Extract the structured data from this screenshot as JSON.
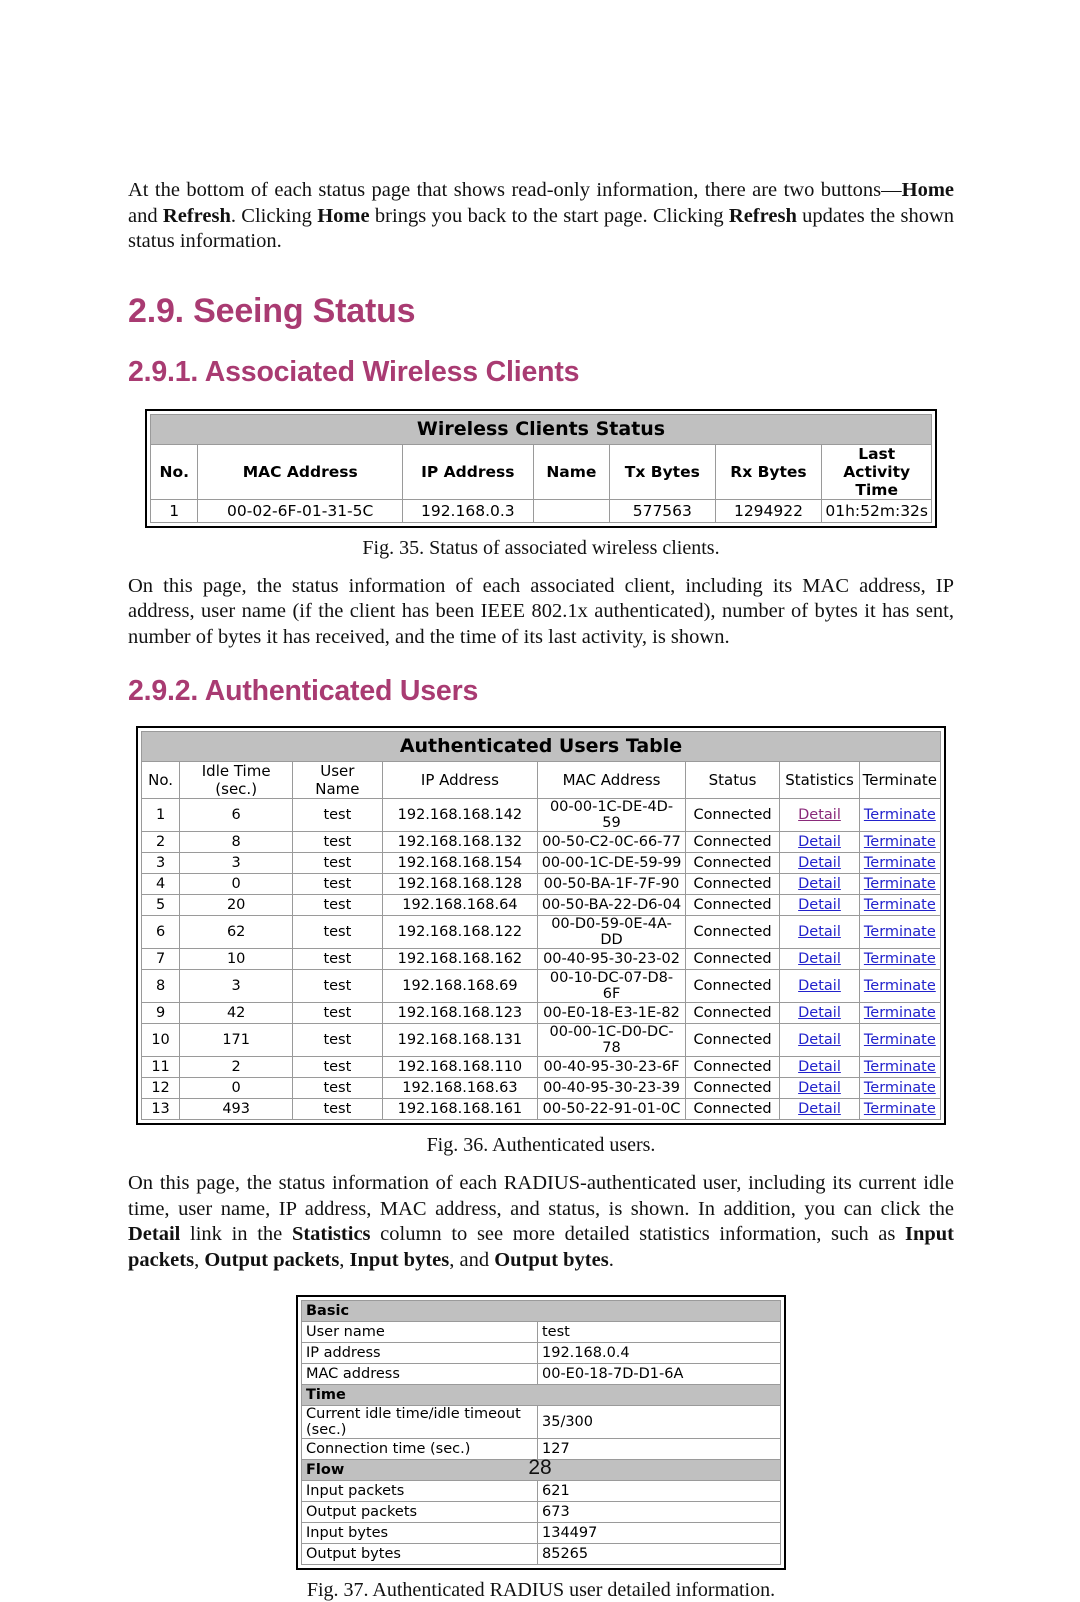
{
  "document": {
    "page_number": "28",
    "heading_color": "#A93B72",
    "link_color": "#2222cc",
    "visited_link_color": "#8a2a7a",
    "table_header_bg": "#c0c0c0"
  },
  "intro_paragraph": {
    "lead": "At the bottom of each status page that shows read-only information, there are two buttons—",
    "bold_home_1": "Home",
    "mid_1": " and ",
    "bold_refresh_1": "Refresh",
    "mid_2": ". Clicking ",
    "bold_home_2": "Home",
    "mid_3": " brings you back to the start page. Clicking ",
    "bold_refresh_2": "Refresh",
    "tail": " updates the shown status information."
  },
  "headings": {
    "section": "2.9. Seeing Status",
    "subsection_1": "2.9.1. Associated Wireless Clients",
    "subsection_2": "2.9.2. Authenticated Users"
  },
  "wireless_clients_status": {
    "title": "Wireless Clients Status",
    "columns": [
      "No.",
      "MAC Address",
      "IP Address",
      "Name",
      "Tx Bytes",
      "Rx Bytes",
      "Last Activity Time"
    ],
    "rows": [
      {
        "no": "1",
        "mac_address": "00-02-6F-01-31-5C",
        "ip_address": "192.168.0.3",
        "name": "",
        "tx_bytes": "577563",
        "rx_bytes": "1294922",
        "last_activity_time": "01h:52m:32s"
      }
    ]
  },
  "caption_fig35": "Fig. 35. Status of associated wireless clients.",
  "paragraph_wireless": "On this page, the status information of each associated client, including its MAC address, IP address, user name (if the client has been IEEE 802.1x authenticated), number of bytes it has sent, number of bytes it has received, and the time of its last activity, is shown.",
  "authenticated_users_table": {
    "title": "Authenticated Users Table",
    "columns": [
      "No.",
      "Idle Time (sec.)",
      "User Name",
      "IP Address",
      "MAC Address",
      "Status",
      "Statistics",
      "Terminate"
    ],
    "detail_label": "Detail",
    "terminate_label": "Terminate",
    "rows": [
      {
        "no": "1",
        "idle_time": "6",
        "user_name": "test",
        "ip_address": "192.168.168.142",
        "mac_address": "00-00-1C-DE-4D-59",
        "status": "Connected",
        "statistics": "Detail",
        "terminate": "Terminate",
        "visited": true
      },
      {
        "no": "2",
        "idle_time": "8",
        "user_name": "test",
        "ip_address": "192.168.168.132",
        "mac_address": "00-50-C2-0C-66-77",
        "status": "Connected",
        "statistics": "Detail",
        "terminate": "Terminate",
        "visited": false
      },
      {
        "no": "3",
        "idle_time": "3",
        "user_name": "test",
        "ip_address": "192.168.168.154",
        "mac_address": "00-00-1C-DE-59-99",
        "status": "Connected",
        "statistics": "Detail",
        "terminate": "Terminate",
        "visited": false
      },
      {
        "no": "4",
        "idle_time": "0",
        "user_name": "test",
        "ip_address": "192.168.168.128",
        "mac_address": "00-50-BA-1F-7F-90",
        "status": "Connected",
        "statistics": "Detail",
        "terminate": "Terminate",
        "visited": false
      },
      {
        "no": "5",
        "idle_time": "20",
        "user_name": "test",
        "ip_address": "192.168.168.64",
        "mac_address": "00-50-BA-22-D6-04",
        "status": "Connected",
        "statistics": "Detail",
        "terminate": "Terminate",
        "visited": false
      },
      {
        "no": "6",
        "idle_time": "62",
        "user_name": "test",
        "ip_address": "192.168.168.122",
        "mac_address": "00-D0-59-0E-4A-DD",
        "status": "Connected",
        "statistics": "Detail",
        "terminate": "Terminate",
        "visited": false
      },
      {
        "no": "7",
        "idle_time": "10",
        "user_name": "test",
        "ip_address": "192.168.168.162",
        "mac_address": "00-40-95-30-23-02",
        "status": "Connected",
        "statistics": "Detail",
        "terminate": "Terminate",
        "visited": false
      },
      {
        "no": "8",
        "idle_time": "3",
        "user_name": "test",
        "ip_address": "192.168.168.69",
        "mac_address": "00-10-DC-07-D8-6F",
        "status": "Connected",
        "statistics": "Detail",
        "terminate": "Terminate",
        "visited": false
      },
      {
        "no": "9",
        "idle_time": "42",
        "user_name": "test",
        "ip_address": "192.168.168.123",
        "mac_address": "00-E0-18-E3-1E-82",
        "status": "Connected",
        "statistics": "Detail",
        "terminate": "Terminate",
        "visited": false
      },
      {
        "no": "10",
        "idle_time": "171",
        "user_name": "test",
        "ip_address": "192.168.168.131",
        "mac_address": "00-00-1C-D0-DC-78",
        "status": "Connected",
        "statistics": "Detail",
        "terminate": "Terminate",
        "visited": false
      },
      {
        "no": "11",
        "idle_time": "2",
        "user_name": "test",
        "ip_address": "192.168.168.110",
        "mac_address": "00-40-95-30-23-6F",
        "status": "Connected",
        "statistics": "Detail",
        "terminate": "Terminate",
        "visited": false
      },
      {
        "no": "12",
        "idle_time": "0",
        "user_name": "test",
        "ip_address": "192.168.168.63",
        "mac_address": "00-40-95-30-23-39",
        "status": "Connected",
        "statistics": "Detail",
        "terminate": "Terminate",
        "visited": false
      },
      {
        "no": "13",
        "idle_time": "493",
        "user_name": "test",
        "ip_address": "192.168.168.161",
        "mac_address": "00-50-22-91-01-0C",
        "status": "Connected",
        "statistics": "Detail",
        "terminate": "Terminate",
        "visited": false
      }
    ]
  },
  "caption_fig36": "Fig. 36. Authenticated users.",
  "paragraph_radius": {
    "part1": "On this page, the status information of each RADIUS-authenticated user, including its current idle time, user name, IP address, MAC address, and status, is shown. In addition, you can click the ",
    "bold1": "Detail",
    "part2": " link in the ",
    "bold2": "Statistics",
    "part3": " column to see more detailed statistics information, such as ",
    "bold3": "Input packets",
    "part4": ", ",
    "bold4": "Output packets",
    "part5": ", ",
    "bold5": "Input bytes",
    "part6": ", and ",
    "bold6": "Output bytes",
    "part7": "."
  },
  "user_detail_table": {
    "sections": [
      {
        "title": "Basic",
        "rows": [
          {
            "key": "User name",
            "value": "test"
          },
          {
            "key": "IP address",
            "value": "192.168.0.4"
          },
          {
            "key": "MAC address",
            "value": "00-E0-18-7D-D1-6A"
          }
        ]
      },
      {
        "title": "Time",
        "rows": [
          {
            "key": "Current idle time/idle timeout (sec.)",
            "value": "35/300"
          },
          {
            "key": "Connection time (sec.)",
            "value": "127"
          }
        ]
      },
      {
        "title": "Flow",
        "rows": [
          {
            "key": "Input packets",
            "value": "621"
          },
          {
            "key": "Output packets",
            "value": "673"
          },
          {
            "key": "Input bytes",
            "value": "134497"
          },
          {
            "key": "Output bytes",
            "value": "85265"
          }
        ]
      }
    ]
  },
  "caption_fig37": "Fig. 37. Authenticated RADIUS user detailed information."
}
